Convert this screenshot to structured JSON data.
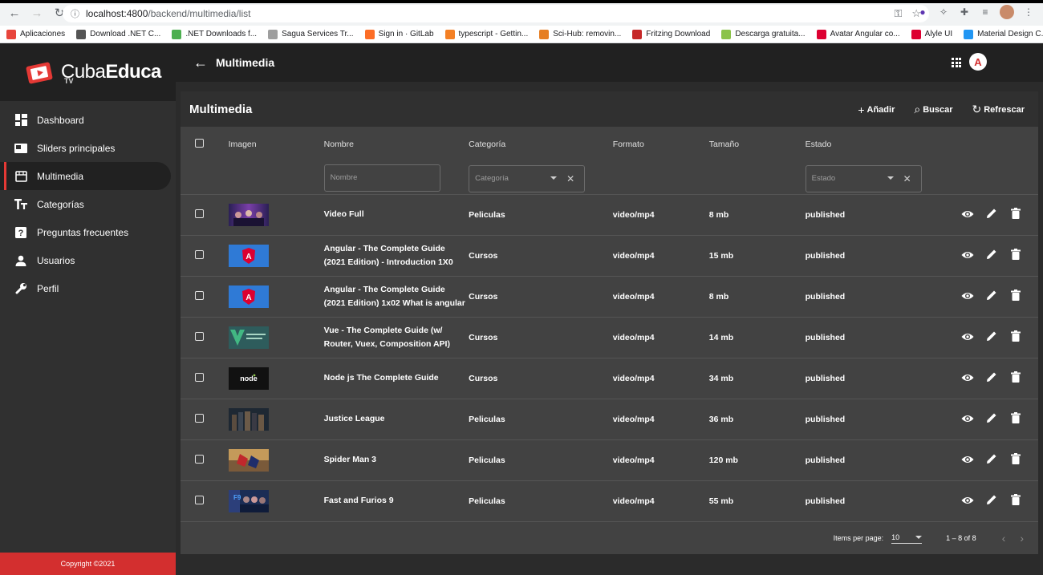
{
  "browser": {
    "url_host": "localhost:4800",
    "url_path": "/backend/multimedia/list",
    "bookmarks": [
      {
        "label": "Aplicaciones",
        "color": "#e8453c"
      },
      {
        "label": "Download .NET C...",
        "color": "#555555"
      },
      {
        "label": ".NET Downloads f...",
        "color": "#4caf50"
      },
      {
        "label": "Sagua Services Tr...",
        "color": "#9e9e9e"
      },
      {
        "label": "Sign in · GitLab",
        "color": "#fc6d26"
      },
      {
        "label": "typescript - Gettin...",
        "color": "#f48024"
      },
      {
        "label": "Sci-Hub: removin...",
        "color": "#e67e22"
      },
      {
        "label": "Fritzing Download",
        "color": "#c62828"
      },
      {
        "label": "Descarga gratuita...",
        "color": "#8bc34a"
      },
      {
        "label": "Avatar Angular co...",
        "color": "#dd0031"
      },
      {
        "label": "Alyle UI",
        "color": "#dd0031"
      },
      {
        "label": "Material Design C...",
        "color": "#2196f3"
      }
    ]
  },
  "sidebar": {
    "logo_bold": "Educa",
    "logo_thin": "Cuba",
    "logo_sub": "TV",
    "items": [
      {
        "label": "Dashboard",
        "icon": "dashboard-icon"
      },
      {
        "label": "Sliders principales",
        "icon": "slider-icon"
      },
      {
        "label": "Multimedia",
        "icon": "multimedia-icon",
        "active": true
      },
      {
        "label": "Categorías",
        "icon": "text-fields-icon"
      },
      {
        "label": "Preguntas frecuentes",
        "icon": "help-icon"
      },
      {
        "label": "Usuarios",
        "icon": "person-icon"
      },
      {
        "label": "Perfil",
        "icon": "wrench-icon"
      }
    ],
    "copyright": "Copyright ©2021"
  },
  "toolbar": {
    "title": "Multimedia",
    "user_initial": "A"
  },
  "card": {
    "title": "Multimedia",
    "actions": {
      "add": "Añadir",
      "search": "Buscar",
      "refresh": "Refrescar"
    }
  },
  "table": {
    "columns": {
      "image": "Imagen",
      "name": "Nombre",
      "category": "Categoría",
      "format": "Formato",
      "size": "Tamaño",
      "status": "Estado"
    },
    "filters": {
      "name_placeholder": "Nombre",
      "category_placeholder": "Categoría",
      "status_placeholder": "Estado"
    },
    "rows": [
      {
        "name_l1": "Video Full",
        "name_l2": "",
        "category": "Peliculas",
        "format": "video/mp4",
        "size": "8 mb",
        "status": "published",
        "thumb": "avengers"
      },
      {
        "name_l1": "Angular - The Complete Guide",
        "name_l2": "(2021 Edition) - Introduction 1X0",
        "category": "Cursos",
        "format": "video/mp4",
        "size": "15 mb",
        "status": "published",
        "thumb": "angular"
      },
      {
        "name_l1": "Angular - The Complete Guide",
        "name_l2": "(2021 Edition) 1x02 What is angular",
        "category": "Cursos",
        "format": "video/mp4",
        "size": "8 mb",
        "status": "published",
        "thumb": "angular"
      },
      {
        "name_l1": "Vue - The Complete Guide (w/",
        "name_l2": "Router, Vuex, Composition API)",
        "category": "Cursos",
        "format": "video/mp4",
        "size": "14 mb",
        "status": "published",
        "thumb": "vue"
      },
      {
        "name_l1": "Node js The Complete Guide",
        "name_l2": "",
        "category": "Cursos",
        "format": "video/mp4",
        "size": "34 mb",
        "status": "published",
        "thumb": "node"
      },
      {
        "name_l1": "Justice League",
        "name_l2": "",
        "category": "Peliculas",
        "format": "video/mp4",
        "size": "36 mb",
        "status": "published",
        "thumb": "justice"
      },
      {
        "name_l1": "Spider Man 3",
        "name_l2": "",
        "category": "Peliculas",
        "format": "video/mp4",
        "size": "120 mb",
        "status": "published",
        "thumb": "spider"
      },
      {
        "name_l1": "Fast and Furios 9",
        "name_l2": "",
        "category": "Peliculas",
        "format": "video/mp4",
        "size": "55 mb",
        "status": "published",
        "thumb": "fast"
      }
    ]
  },
  "paginator": {
    "items_per_page_label": "Items per page:",
    "items_per_page_value": "10",
    "range": "1 – 8 of 8"
  }
}
